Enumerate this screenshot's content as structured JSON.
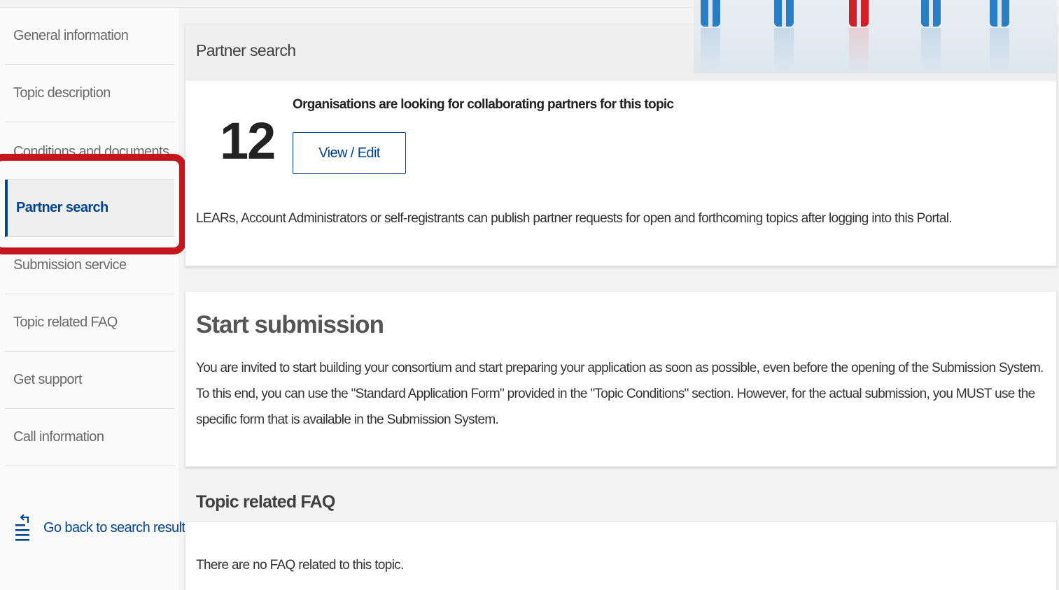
{
  "sidebar": {
    "items": [
      {
        "label": "General information"
      },
      {
        "label": "Topic description"
      },
      {
        "label": "Conditions and documents"
      },
      {
        "label": "Partner search"
      },
      {
        "label": "Submission service"
      },
      {
        "label": "Topic related FAQ"
      },
      {
        "label": "Get support"
      },
      {
        "label": "Call information"
      }
    ],
    "active_index": 3,
    "back_link": "Go back to search results"
  },
  "partner_search": {
    "title": "Partner search",
    "count": "12",
    "heading": "Organisations are looking for collaborating partners for this topic",
    "button_label": "View / Edit",
    "note": "LEARs, Account Administrators or self-registrants can publish partner requests for open and forthcoming topics after logging into this Portal."
  },
  "start_submission": {
    "title": "Start submission",
    "text": "You are invited to start building your consortium and start preparing your application as soon as possible, even before the opening of the Submission System. To this end, you can use the \"Standard Application Form\" provided in the \"Topic Conditions\" section. However, for the actual submission, you MUST use the specific form that is available in the Submission System."
  },
  "faq": {
    "title": "Topic related FAQ",
    "empty_text": "There are no FAQ related to this topic."
  },
  "colors": {
    "brand_blue": "#004494",
    "highlight_red": "#c4161c",
    "figure_blue": "#2a7fc4",
    "figure_red": "#d21f26"
  },
  "icons": {
    "back": "list-return-icon"
  }
}
